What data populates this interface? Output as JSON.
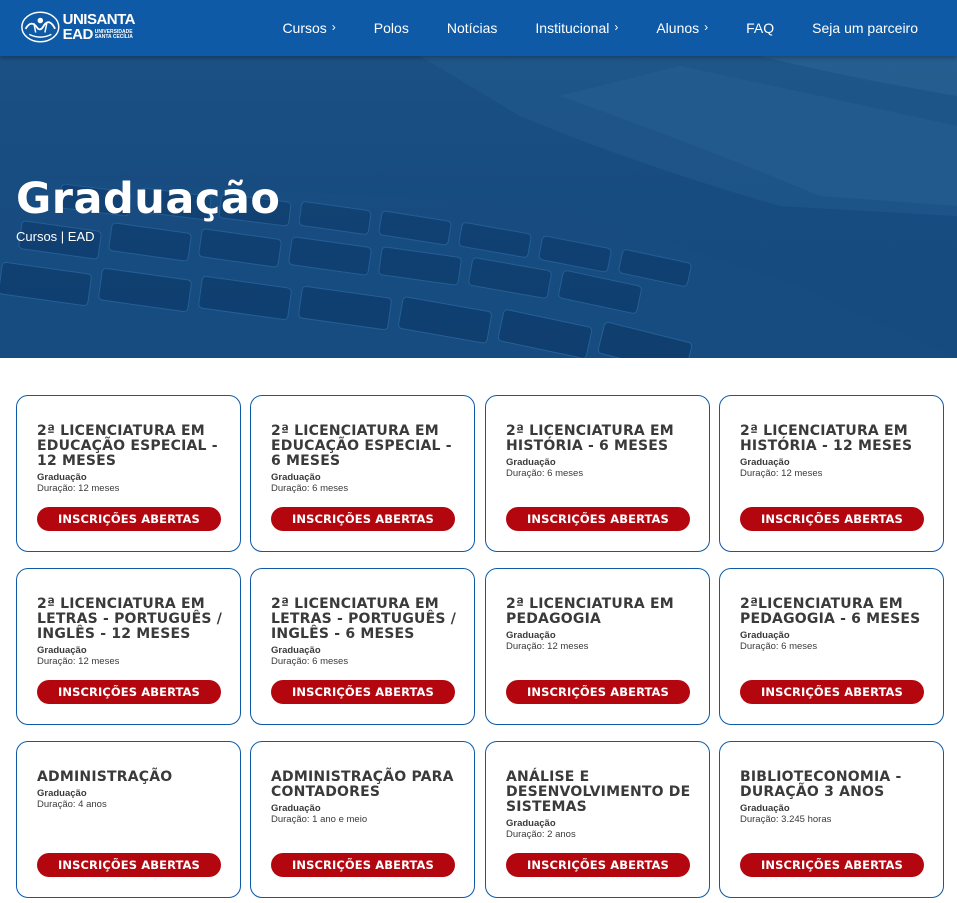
{
  "header": {
    "logo": {
      "top": "UNISANTA",
      "ead": "EAD",
      "sub1": "UNIVERSIDADE",
      "sub2": "SANTA CECÍLIA"
    },
    "nav": [
      {
        "label": "Cursos",
        "has_chevron": true
      },
      {
        "label": "Polos",
        "has_chevron": false
      },
      {
        "label": "Notícias",
        "has_chevron": false
      },
      {
        "label": "Institucional",
        "has_chevron": true
      },
      {
        "label": "Alunos",
        "has_chevron": true
      },
      {
        "label": "FAQ",
        "has_chevron": false
      },
      {
        "label": "Seja um parceiro",
        "has_chevron": false
      }
    ],
    "chevron_glyph": "›"
  },
  "hero": {
    "title": "Graduação",
    "breadcrumb": [
      "Cursos",
      " | ",
      "EAD"
    ]
  },
  "courses": [
    {
      "title": "2ª LICENCIATURA EM EDUCAÇÃO ESPECIAL - 12 MESES",
      "level": "Graduação",
      "duration": "Duração: 12 meses",
      "button": "INSCRIÇÕES ABERTAS"
    },
    {
      "title": "2ª LICENCIATURA EM EDUCAÇÃO ESPECIAL - 6 MESES",
      "level": "Graduação",
      "duration": "Duração: 6 meses",
      "button": "INSCRIÇÕES ABERTAS"
    },
    {
      "title": "2ª LICENCIATURA EM HISTÓRIA - 6 MESES",
      "level": "Graduação",
      "duration": "Duração: 6 meses",
      "button": "INSCRIÇÕES ABERTAS"
    },
    {
      "title": "2ª LICENCIATURA EM HISTÓRIA - 12 MESES",
      "level": "Graduação",
      "duration": "Duração: 12 meses",
      "button": "INSCRIÇÕES ABERTAS"
    },
    {
      "title": "2ª LICENCIATURA EM LETRAS - PORTUGUÊS / INGLÊS - 12 MESES",
      "level": "Graduação",
      "duration": "Duração: 12 meses",
      "button": "INSCRIÇÕES ABERTAS"
    },
    {
      "title": "2ª LICENCIATURA EM LETRAS - PORTUGUÊS / INGLÊS - 6 MESES",
      "level": "Graduação",
      "duration": "Duração: 6 meses",
      "button": "INSCRIÇÕES ABERTAS"
    },
    {
      "title": "2ª LICENCIATURA EM PEDAGOGIA",
      "level": "Graduação",
      "duration": "Duração: 12 meses",
      "button": "INSCRIÇÕES ABERTAS"
    },
    {
      "title": "2ªLICENCIATURA EM PEDAGOGIA - 6 MESES",
      "level": "Graduação",
      "duration": "Duração: 6 meses",
      "button": "INSCRIÇÕES ABERTAS"
    },
    {
      "title": "ADMINISTRAÇÃO",
      "level": "Graduação",
      "duration": "Duração: 4 anos",
      "button": "INSCRIÇÕES ABERTAS"
    },
    {
      "title": "ADMINISTRAÇÃO PARA CONTADORES",
      "level": "Graduação",
      "duration": "Duração: 1 ano e meio",
      "button": "INSCRIÇÕES ABERTAS"
    },
    {
      "title": "ANÁLISE E DESENVOLVIMENTO DE SISTEMAS",
      "level": "Graduação",
      "duration": "Duração: 2 anos",
      "button": "INSCRIÇÕES ABERTAS"
    },
    {
      "title": "BIBLIOTECONOMIA - DURAÇÃO 3 ANOS",
      "level": "Graduação",
      "duration": "Duração: 3.245 horas",
      "button": "INSCRIÇÕES ABERTAS"
    }
  ],
  "colors": {
    "header": "#0e5aa6",
    "accent_button": "#b3060f",
    "card_border": "#0e5aa6"
  }
}
